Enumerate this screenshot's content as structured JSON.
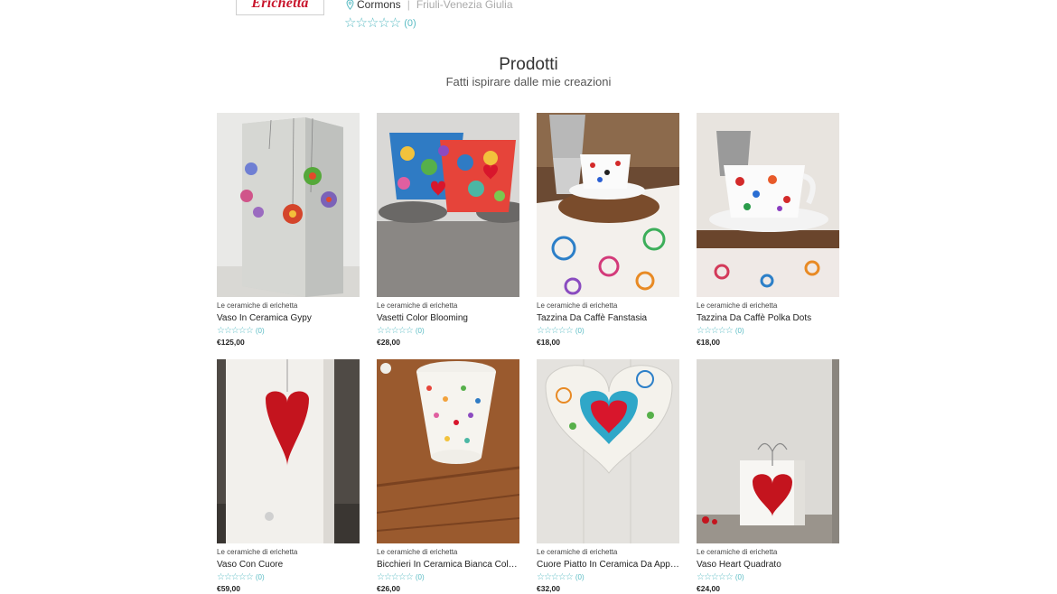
{
  "shop": {
    "logo_text": "Erichetta",
    "city": "Cormons",
    "separator": "|",
    "region": "Friuli-Venezia Giulia",
    "stars": "☆☆☆☆☆",
    "rating_count": "(0)"
  },
  "section": {
    "title": "Prodotti",
    "subtitle": "Fatti ispirare dalle mie creazioni"
  },
  "products": [
    {
      "seller": "Le ceramiche di erichetta",
      "name": "Vaso In Ceramica Gypy",
      "stars": "☆☆☆☆☆",
      "rating_count": "(0)",
      "price": "€125,00",
      "image": "grey-vase-flowers"
    },
    {
      "seller": "Le ceramiche di erichetta",
      "name": "Vasetti Color Blooming",
      "stars": "☆☆☆☆☆",
      "rating_count": "(0)",
      "price": "€28,00",
      "image": "colorful-cups"
    },
    {
      "seller": "Le ceramiche di erichetta",
      "name": "Tazzina Da Caffè Fanstasia",
      "stars": "☆☆☆☆☆",
      "rating_count": "(0)",
      "price": "€18,00",
      "image": "espresso-cup-moka"
    },
    {
      "seller": "Le ceramiche di erichetta",
      "name": "Tazzina Da Caffè Polka Dots",
      "stars": "☆☆☆☆☆",
      "rating_count": "(0)",
      "price": "€18,00",
      "image": "polka-dot-cup"
    },
    {
      "seller": "Le ceramiche di erichetta",
      "name": "Vaso Con Cuore",
      "stars": "☆☆☆☆☆",
      "rating_count": "(0)",
      "price": "€59,00",
      "image": "white-vase-red-heart"
    },
    {
      "seller": "Le ceramiche di erichetta",
      "name": "Bicchieri In Ceramica Bianca Colors O...",
      "stars": "☆☆☆☆☆",
      "rating_count": "(0)",
      "price": "€26,00",
      "image": "white-cup-small-hearts"
    },
    {
      "seller": "Le ceramiche di erichetta",
      "name": "Cuore Piatto In Ceramica Da Appendere",
      "stars": "☆☆☆☆☆",
      "rating_count": "(0)",
      "price": "€32,00",
      "image": "hanging-heart-plate"
    },
    {
      "seller": "Le ceramiche di erichetta",
      "name": "Vaso Heart Quadrato",
      "stars": "☆☆☆☆☆",
      "rating_count": "(0)",
      "price": "€24,00",
      "image": "square-vase-heart"
    }
  ]
}
